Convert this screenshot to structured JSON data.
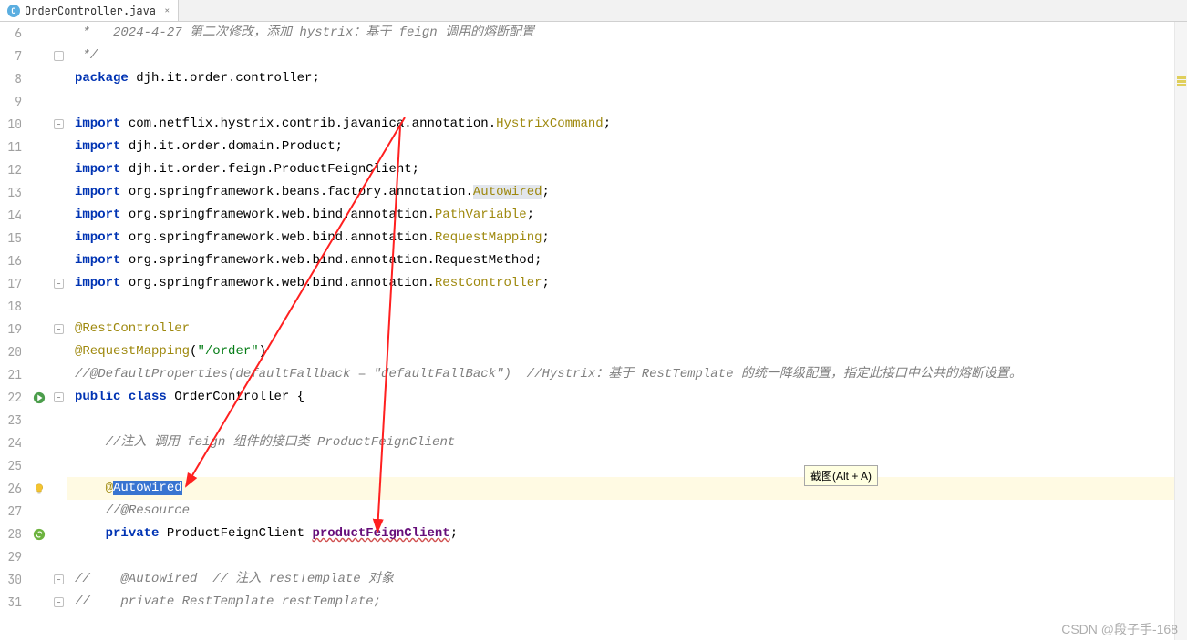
{
  "tab": {
    "icon_letter": "C",
    "title": "OrderController.java",
    "close": "×"
  },
  "tooltip": "截图(Alt + A)",
  "watermark": "CSDN @段子手-168",
  "lines": [
    {
      "num": 6,
      "fold": "",
      "tokens": [
        {
          "cls": "comment",
          "t": " *   2024-4-27 第二次修改，添加 hystrix：基于 feign 调用的熔断配置"
        }
      ]
    },
    {
      "num": 7,
      "fold": "⌐",
      "tokens": [
        {
          "cls": "comment",
          "t": " */"
        }
      ]
    },
    {
      "num": 8,
      "fold": "",
      "tokens": [
        {
          "cls": "kw",
          "t": "package"
        },
        {
          "t": " djh.it.order.controller;"
        }
      ]
    },
    {
      "num": 9,
      "fold": "",
      "tokens": []
    },
    {
      "num": 10,
      "fold": "⌐",
      "tokens": [
        {
          "cls": "kw",
          "t": "import"
        },
        {
          "t": " com.netflix.hystrix.contrib.javanica.annotation."
        },
        {
          "cls": "ann",
          "t": "HystrixCommand"
        },
        {
          "t": ";"
        }
      ]
    },
    {
      "num": 11,
      "fold": "",
      "tokens": [
        {
          "cls": "kw",
          "t": "import"
        },
        {
          "t": " djh.it.order.domain.Product;"
        }
      ]
    },
    {
      "num": 12,
      "fold": "",
      "tokens": [
        {
          "cls": "kw",
          "t": "import"
        },
        {
          "t": " djh.it.order.feign.ProductFeignClient;"
        }
      ]
    },
    {
      "num": 13,
      "fold": "",
      "tokens": [
        {
          "cls": "kw",
          "t": "import"
        },
        {
          "t": " org.springframework.beans.factory.annotation."
        },
        {
          "cls": "ann hl-word",
          "t": "Autowired"
        },
        {
          "t": ";"
        }
      ]
    },
    {
      "num": 14,
      "fold": "",
      "tokens": [
        {
          "cls": "kw",
          "t": "import"
        },
        {
          "t": " org.springframework.web.bind.annotation."
        },
        {
          "cls": "ann",
          "t": "PathVariable"
        },
        {
          "t": ";"
        }
      ]
    },
    {
      "num": 15,
      "fold": "",
      "tokens": [
        {
          "cls": "kw",
          "t": "import"
        },
        {
          "t": " org.springframework.web.bind.annotation."
        },
        {
          "cls": "ann",
          "t": "RequestMapping"
        },
        {
          "t": ";"
        }
      ]
    },
    {
      "num": 16,
      "fold": "",
      "tokens": [
        {
          "cls": "kw",
          "t": "import"
        },
        {
          "t": " org.springframework.web.bind.annotation.RequestMethod;"
        }
      ]
    },
    {
      "num": 17,
      "fold": "⌐",
      "tokens": [
        {
          "cls": "kw",
          "t": "import"
        },
        {
          "t": " org.springframework.web.bind.annotation."
        },
        {
          "cls": "ann",
          "t": "RestController"
        },
        {
          "t": ";"
        }
      ]
    },
    {
      "num": 18,
      "fold": "",
      "tokens": []
    },
    {
      "num": 19,
      "fold": "⌐",
      "tokens": [
        {
          "cls": "ann",
          "t": "@RestController"
        }
      ]
    },
    {
      "num": 20,
      "fold": "",
      "tokens": [
        {
          "cls": "ann",
          "t": "@RequestMapping"
        },
        {
          "t": "("
        },
        {
          "cls": "str",
          "t": "\"/order\""
        },
        {
          "t": ")"
        }
      ]
    },
    {
      "num": 21,
      "fold": "",
      "tokens": [
        {
          "cls": "comment",
          "t": "//@DefaultProperties(defaultFallback = \"defaultFallBack\")  //Hystrix：基于 RestTemplate 的统一降级配置，指定此接口中公共的熔断设置。"
        }
      ]
    },
    {
      "num": 22,
      "fold": "⌐",
      "icon": "run",
      "tokens": [
        {
          "cls": "kw",
          "t": "public"
        },
        {
          "t": " "
        },
        {
          "cls": "kw",
          "t": "class"
        },
        {
          "t": " "
        },
        {
          "cls": "typ",
          "t": "OrderController"
        },
        {
          "t": " {"
        }
      ]
    },
    {
      "num": 23,
      "fold": "",
      "tokens": []
    },
    {
      "num": 24,
      "fold": "",
      "tokens": [
        {
          "t": "    "
        },
        {
          "cls": "comment",
          "t": "//注入 调用 feign 组件的接口类 ProductFeignClient"
        }
      ]
    },
    {
      "num": 25,
      "fold": "",
      "tokens": []
    },
    {
      "num": 26,
      "fold": "",
      "hl": true,
      "icon": "bulb",
      "tokens": [
        {
          "t": "    "
        },
        {
          "cls": "ann",
          "t": "@"
        },
        {
          "cls": "sel",
          "t": "Autowired"
        }
      ]
    },
    {
      "num": 27,
      "fold": "",
      "tokens": [
        {
          "t": "    "
        },
        {
          "cls": "comment",
          "t": "//@Resource"
        }
      ]
    },
    {
      "num": 28,
      "fold": "",
      "icon": "spring",
      "tokens": [
        {
          "t": "    "
        },
        {
          "cls": "kw",
          "t": "private"
        },
        {
          "t": " "
        },
        {
          "cls": "typ",
          "t": "ProductFeignClient"
        },
        {
          "t": " "
        },
        {
          "cls": "field",
          "t": "productFeignClient"
        },
        {
          "t": ";"
        }
      ]
    },
    {
      "num": 29,
      "fold": "",
      "tokens": []
    },
    {
      "num": 30,
      "fold": "⌐",
      "tokens": [
        {
          "cls": "comment",
          "t": "//    @Autowired  // 注入 restTemplate 对象"
        }
      ]
    },
    {
      "num": 31,
      "fold": "⌐",
      "tokens": [
        {
          "cls": "comment",
          "t": "//    private RestTemplate restTemplate;"
        }
      ]
    }
  ]
}
